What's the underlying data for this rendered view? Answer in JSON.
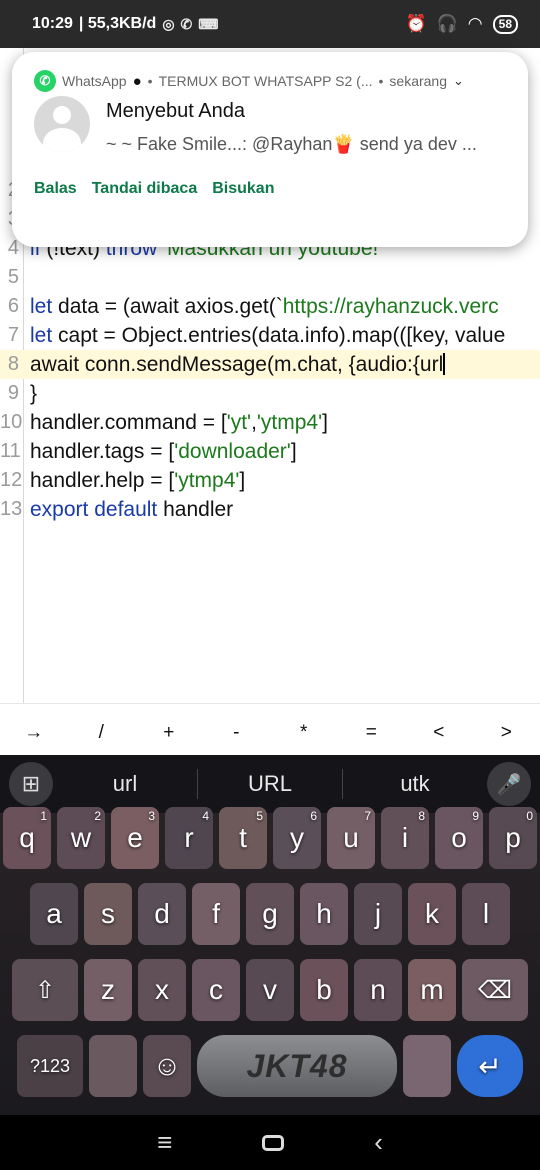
{
  "status_bar": {
    "time": "10:29",
    "net_speed": "| 55,3KB/d",
    "battery": "58"
  },
  "notification": {
    "app": "WhatsApp",
    "group": "TERMUX BOT WHATSAPP S2 (...",
    "when": "sekarang",
    "title": "Menyebut Anda",
    "message": "~ ~ Fake Smile...: @Rayhan🍟 send ya dev ...",
    "actions": [
      "Balas",
      "Tandai dibaca",
      "Bisukan"
    ]
  },
  "editor": {
    "line_numbers": [
      "2",
      "3",
      "4",
      "5",
      "6",
      "7",
      "8",
      "9",
      "10",
      "11",
      "12",
      "13"
    ],
    "lines": {
      "l4_kw": "if",
      "l4_mid": " (!text) ",
      "l4_kw2": "throw",
      "l4_str": " 'Masukkan url youtube!'",
      "l6_kw": "let",
      "l6_rest": " data = (await axios.get(`",
      "l6_str": "https://rayhanzuck.verc",
      "l7_kw": "let",
      "l7_rest": " capt = Object.entries(data.info).map(([key, value",
      "l8": "await conn.sendMessage(m.chat, {audio:{url",
      "l9": "}",
      "l10_a": "handler.command = [",
      "l10_s1": "'yt'",
      "l10_c": ",",
      "l10_s2": "'ytmp4'",
      "l10_b": "]",
      "l11_a": "handler.tags = [",
      "l11_s": "'downloader'",
      "l11_b": "]",
      "l12_a": "handler.help = [",
      "l12_s": "'ytmp4'",
      "l12_b": "]",
      "l13_kw1": "export",
      "l13_kw2": "default",
      "l13_rest": " handler"
    }
  },
  "extra_keys": [
    "→",
    "/",
    "+",
    "-",
    "*",
    "=",
    "<",
    ">"
  ],
  "keyboard": {
    "suggestions": [
      "url",
      "URL",
      "utk"
    ],
    "row1": [
      [
        "q",
        "1"
      ],
      [
        "w",
        "2"
      ],
      [
        "e",
        "3"
      ],
      [
        "r",
        "4"
      ],
      [
        "t",
        "5"
      ],
      [
        "y",
        "6"
      ],
      [
        "u",
        "7"
      ],
      [
        "i",
        "8"
      ],
      [
        "o",
        "9"
      ],
      [
        "p",
        "0"
      ]
    ],
    "row2": [
      "a",
      "s",
      "d",
      "f",
      "g",
      "h",
      "j",
      "k",
      "l"
    ],
    "row3": [
      "z",
      "x",
      "c",
      "v",
      "b",
      "n",
      "m"
    ],
    "symbols_label": "?123",
    "space_label": "JKT48",
    "enter_glyph": "↵"
  },
  "colors": {
    "whatsapp_green": "#25d366",
    "action_green": "#0d7a4a",
    "keyword_blue": "#1a3aa8",
    "string_green": "#1c7a1c",
    "enter_blue": "#2f6fd8"
  }
}
